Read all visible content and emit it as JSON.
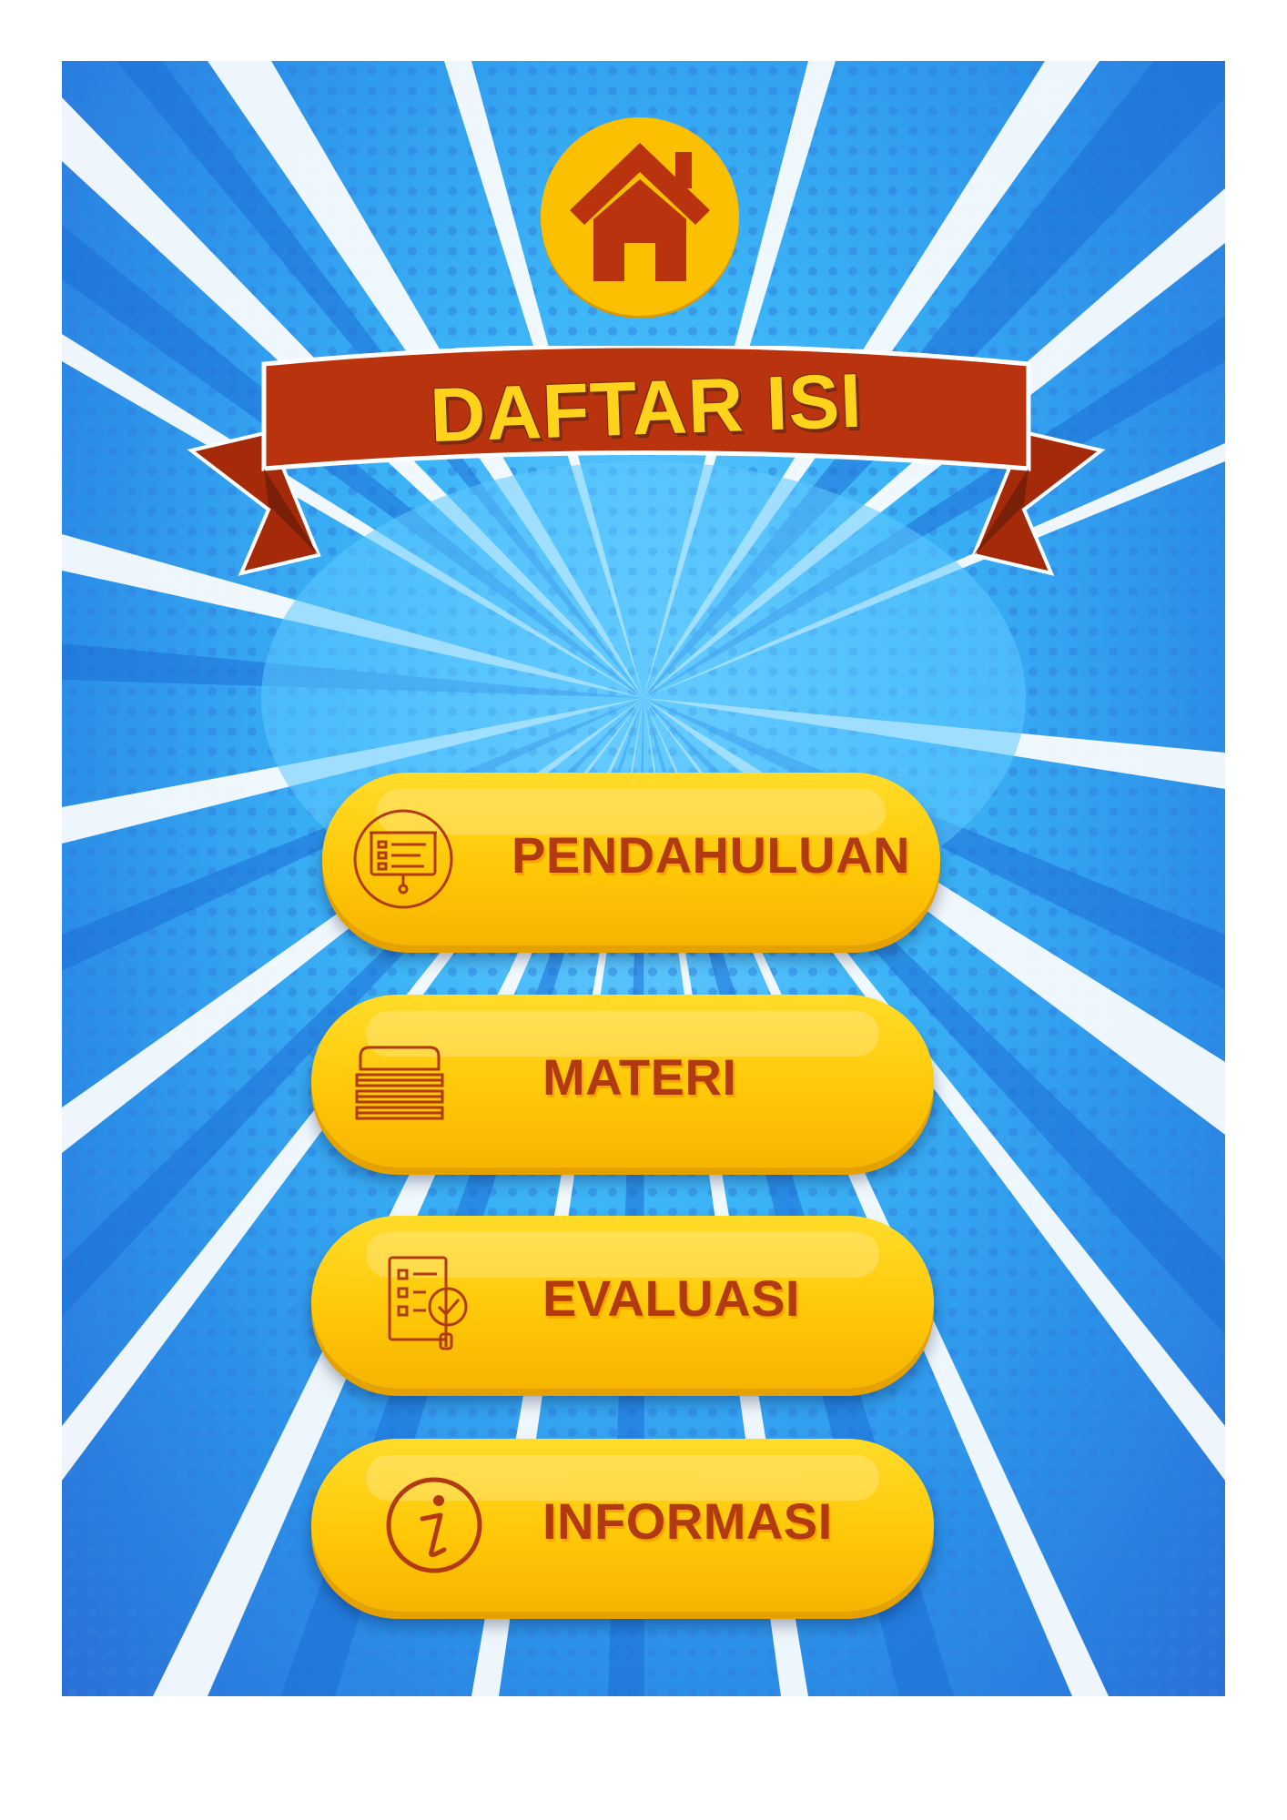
{
  "title": "DAFTAR ISI",
  "home": {
    "icon": "home-icon"
  },
  "menu": [
    {
      "label": "PENDAHULUAN",
      "icon": "presentation-board-icon"
    },
    {
      "label": "MATERI",
      "icon": "stacked-layers-icon"
    },
    {
      "label": "EVALUASI",
      "icon": "checklist-inspect-icon"
    },
    {
      "label": "INFORMASI",
      "icon": "info-icon"
    }
  ],
  "colors": {
    "background": "#3cb4f7",
    "button": "#ffc808",
    "button_text": "#b23a10",
    "ribbon": "#b8330e",
    "title_text": "#ffd21c",
    "home_button": "#fbc000",
    "home_icon": "#b8330e"
  }
}
